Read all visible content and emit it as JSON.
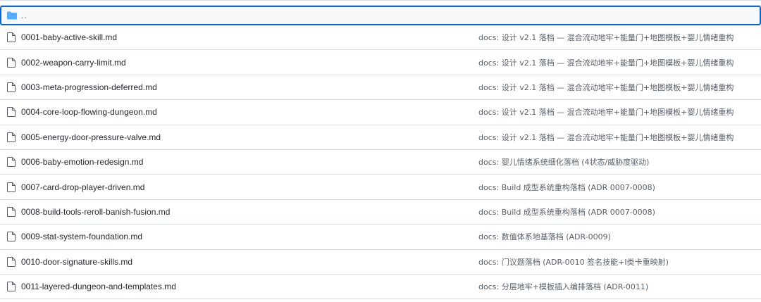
{
  "parent_dir": {
    "label": "..",
    "icon": "folder-icon",
    "color": "#54aeff"
  },
  "files": [
    {
      "name": "0001-baby-active-skill.md",
      "commit": "docs: 设计 v2.1 落档 — 混合流动地牢+能量门+地图模板+婴儿情绪重构",
      "icon": "file-icon"
    },
    {
      "name": "0002-weapon-carry-limit.md",
      "commit": "docs: 设计 v2.1 落档 — 混合流动地牢+能量门+地图模板+婴儿情绪重构",
      "icon": "file-icon"
    },
    {
      "name": "0003-meta-progression-deferred.md",
      "commit": "docs: 设计 v2.1 落档 — 混合流动地牢+能量门+地图模板+婴儿情绪重构",
      "icon": "file-icon"
    },
    {
      "name": "0004-core-loop-flowing-dungeon.md",
      "commit": "docs: 设计 v2.1 落档 — 混合流动地牢+能量门+地图模板+婴儿情绪重构",
      "icon": "file-icon"
    },
    {
      "name": "0005-energy-door-pressure-valve.md",
      "commit": "docs: 设计 v2.1 落档 — 混合流动地牢+能量门+地图模板+婴儿情绪重构",
      "icon": "file-icon"
    },
    {
      "name": "0006-baby-emotion-redesign.md",
      "commit": "docs: 婴儿情绪系统细化落档 (4状态/威胁度驱动)",
      "icon": "file-icon"
    },
    {
      "name": "0007-card-drop-player-driven.md",
      "commit": "docs: Build 成型系统重构落档 (ADR 0007-0008)",
      "icon": "file-icon"
    },
    {
      "name": "0008-build-tools-reroll-banish-fusion.md",
      "commit": "docs: Build 成型系统重构落档 (ADR 0007-0008)",
      "icon": "file-icon"
    },
    {
      "name": "0009-stat-system-foundation.md",
      "commit": "docs: 数值体系地基落档 (ADR-0009)",
      "icon": "file-icon"
    },
    {
      "name": "0010-door-signature-skills.md",
      "commit": "docs: 门议题落档 (ADR-0010 签名技能+I类卡重映射)",
      "icon": "file-icon"
    },
    {
      "name": "0011-layered-dungeon-and-templates.md",
      "commit": "docs: 分层地牢+模板插入编排落档 (ADR-0011)",
      "icon": "file-icon"
    }
  ]
}
